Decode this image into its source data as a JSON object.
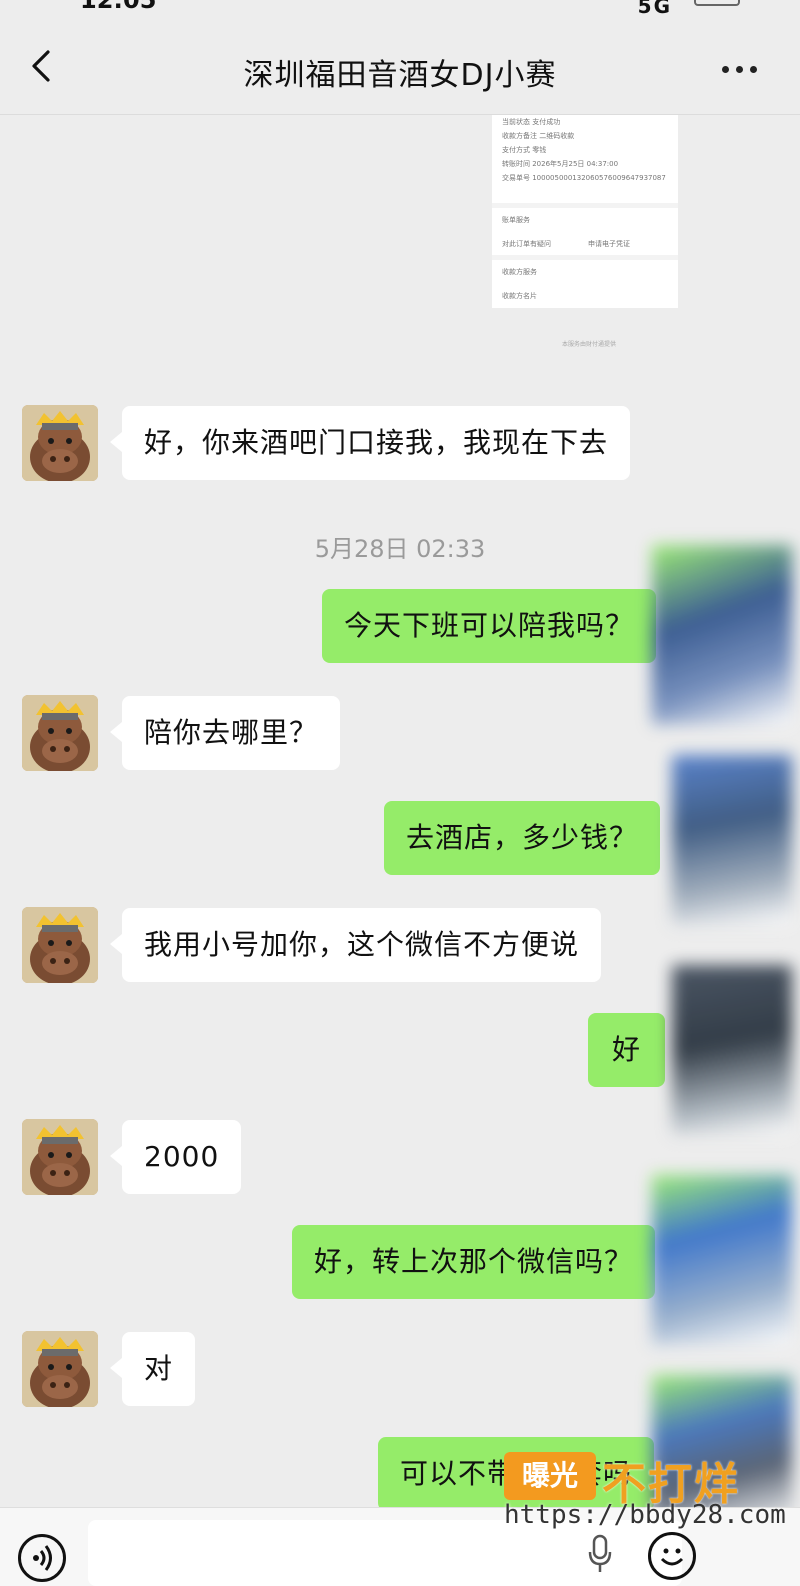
{
  "status_bar": {
    "time": "12:05",
    "signal": "5G"
  },
  "header": {
    "title": "深圳福田音酒女DJ小赛",
    "back_icon": "chevron-left-icon",
    "more_icon": "ellipsis-icon"
  },
  "colors": {
    "self_bubble": "#95ec69",
    "other_bubble": "#ffffff",
    "background": "#ededed",
    "watermark": "#f39a1f"
  },
  "timestamp": "5月28日 02:33",
  "messages": [
    {
      "from": "other",
      "text": "好，你来酒吧门口接我，我现在下去"
    },
    {
      "from": "self",
      "text": "今天下班可以陪我吗？"
    },
    {
      "from": "other",
      "text": "陪你去哪里？"
    },
    {
      "from": "self",
      "text": "去酒店，多少钱？"
    },
    {
      "from": "other",
      "text": "我用小号加你，这个微信不方便说"
    },
    {
      "from": "self",
      "text": "好"
    },
    {
      "from": "other",
      "text": "2000"
    },
    {
      "from": "self",
      "text": "好，转上次那个微信吗？"
    },
    {
      "from": "other",
      "text": "对"
    },
    {
      "from": "self",
      "text": "可以不带避孕套吗"
    }
  ],
  "receipt": {
    "rows": [
      "当前状态 支付成功",
      "收款方备注 二维码收款",
      "支付方式 零钱",
      "转账时间 2026年5月25日 04:37:00",
      "交易单号 100005000132060576009647937087"
    ],
    "section1_title": "账单服务",
    "section1_items": [
      "对此订单有疑问",
      "申请电子凭证"
    ],
    "section2_title": "收款方服务",
    "section2_item": "收款方名片",
    "footer": "本服务由财付通提供"
  },
  "input_bar": {
    "voice_icon": "voice-icon",
    "mic_icon": "mic-icon",
    "emoji_icon": "emoji-icon"
  },
  "watermark": {
    "badge": "曝光",
    "text": "不打烊",
    "url": "https://bbdy28.com"
  }
}
